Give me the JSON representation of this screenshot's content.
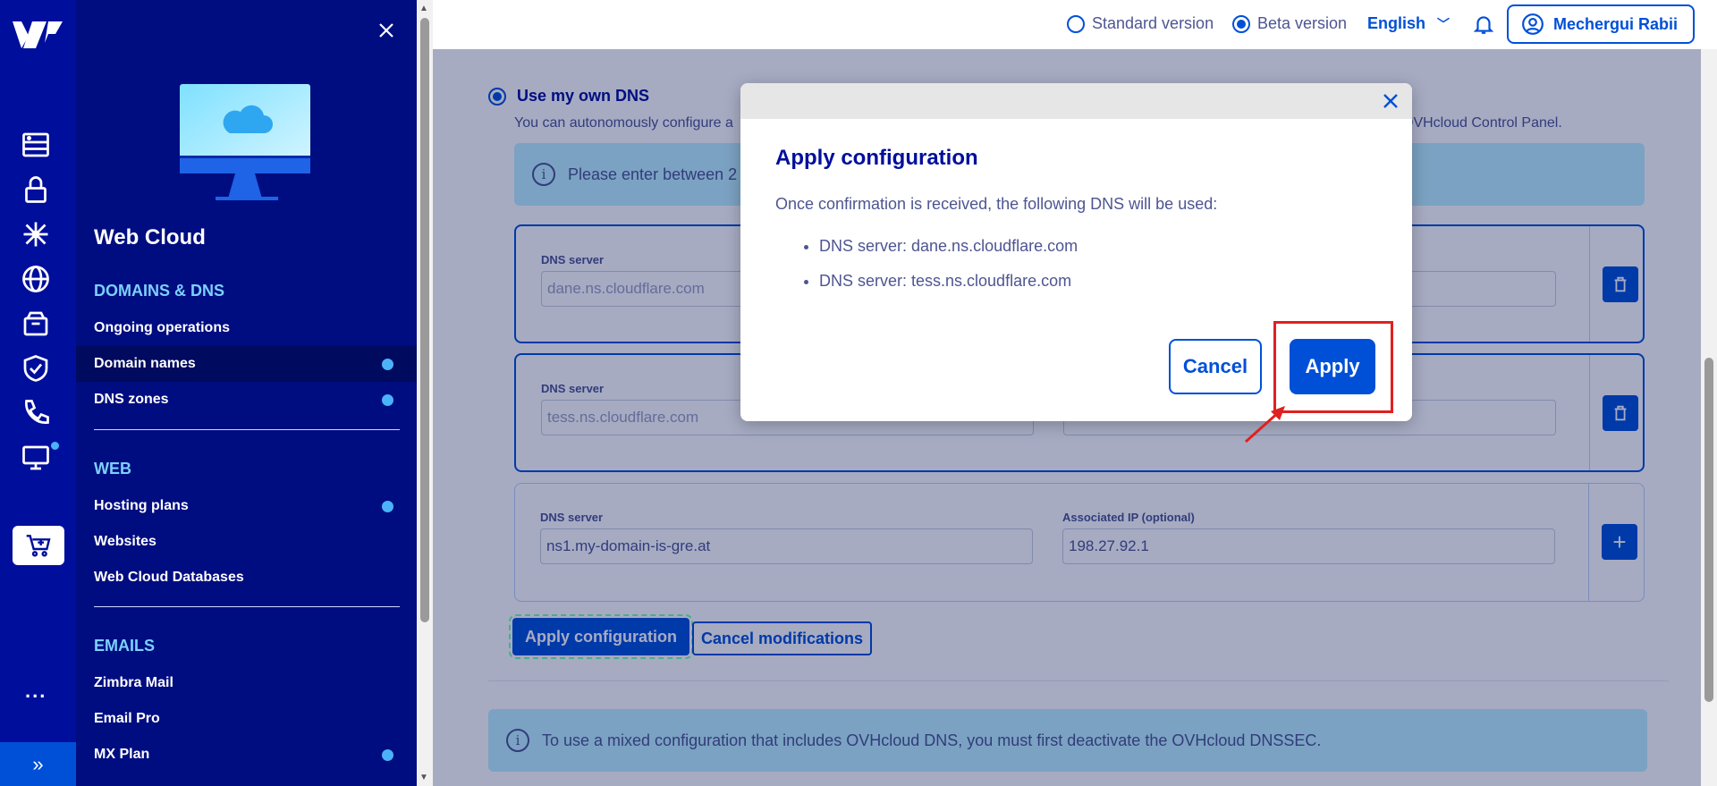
{
  "sidebar": {
    "title": "Web Cloud",
    "sections": [
      {
        "label": "DOMAINS & DNS"
      },
      {
        "label": "WEB"
      },
      {
        "label": "EMAILS"
      }
    ],
    "items": [
      {
        "label": "Ongoing operations"
      },
      {
        "label": "Domain names"
      },
      {
        "label": "DNS zones"
      },
      {
        "label": "Hosting plans"
      },
      {
        "label": "Websites"
      },
      {
        "label": "Web Cloud Databases"
      },
      {
        "label": "Zimbra Mail"
      },
      {
        "label": "Email Pro"
      },
      {
        "label": "MX Plan"
      }
    ],
    "more_label": "...",
    "expand_label": "»"
  },
  "topbar": {
    "standard_version": "Standard version",
    "beta_version": "Beta version",
    "language": "English",
    "user_name": "Mechergui Rabii"
  },
  "dns": {
    "own_dns_label": "Use my own DNS",
    "description": "You can autonomously configure a",
    "description_right": "OVHcloud Control Panel.",
    "info_text": "Please enter between 2",
    "rows": [
      {
        "label": "DNS server",
        "value": "dane.ns.cloudflare.com"
      },
      {
        "label": "DNS server",
        "value": "tess.ns.cloudflare.com"
      },
      {
        "label": "DNS server",
        "value": "ns1.my-domain-is-gre.at",
        "ip_label": "Associated IP (optional)",
        "ip_value": "198.27.92.1"
      }
    ],
    "apply_config_label": "Apply configuration",
    "cancel_mod_label": "Cancel modifications",
    "mixed_info": "To use a mixed configuration that includes OVHcloud DNS, you must first deactivate the OVHcloud DNSSEC."
  },
  "modal": {
    "title": "Apply configuration",
    "text": "Once confirmation is received, the following DNS will be used:",
    "items": [
      "DNS server: dane.ns.cloudflare.com",
      "DNS server: tess.ns.cloudflare.com"
    ],
    "cancel_label": "Cancel",
    "apply_label": "Apply"
  },
  "colors": {
    "brand": "#000e9c",
    "accent": "#0050d7",
    "nav_bg": "#000d80",
    "highlight": "#e02020"
  }
}
